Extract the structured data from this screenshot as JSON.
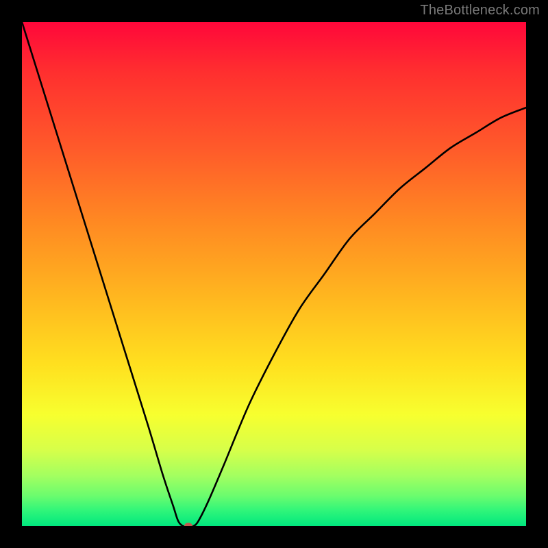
{
  "watermark": "TheBottleneck.com",
  "chart_data": {
    "type": "line",
    "title": "",
    "xlabel": "",
    "ylabel": "",
    "xlim": [
      0,
      100
    ],
    "ylim": [
      0,
      100
    ],
    "grid": false,
    "legend": false,
    "series": [
      {
        "name": "bottleneck-curve",
        "x": [
          0,
          5,
          10,
          15,
          20,
          25,
          28,
          30,
          31,
          32,
          33,
          34,
          35,
          37,
          40,
          45,
          50,
          55,
          60,
          65,
          70,
          75,
          80,
          85,
          90,
          95,
          100
        ],
        "values": [
          100,
          84,
          68,
          52,
          36,
          20,
          10,
          4,
          1,
          0,
          0,
          0,
          1,
          5,
          12,
          24,
          34,
          43,
          50,
          57,
          62,
          67,
          71,
          75,
          78,
          81,
          83
        ]
      }
    ],
    "marker": {
      "name": "optimal-point",
      "x": 33,
      "y": 0
    },
    "background": {
      "type": "vertical-gradient",
      "stops": [
        {
          "pos": 0,
          "color": "#ff073a"
        },
        {
          "pos": 55,
          "color": "#ffb81f"
        },
        {
          "pos": 78,
          "color": "#f7ff2f"
        },
        {
          "pos": 100,
          "color": "#00e77e"
        }
      ]
    }
  }
}
